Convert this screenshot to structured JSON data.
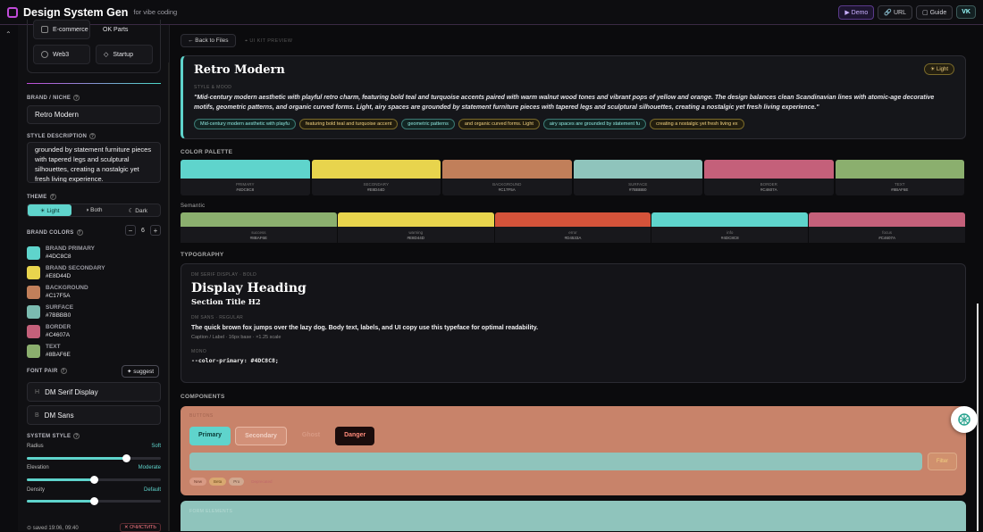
{
  "header": {
    "title": "Design System Gen",
    "subtitle": "for vibe coding",
    "demo": "▶ Demo",
    "url": "URL",
    "guide": "Guide",
    "user": "VK"
  },
  "sidebar": {
    "niches": [
      "E-commerce",
      "OK Parts",
      "Web3",
      "Startup"
    ],
    "brand_label": "BRAND / NICHE",
    "brand_value": "Retro Modern",
    "style_label": "STYLE DESCRIPTION",
    "style_text": "grounded by statement furniture pieces with tapered legs and sculptural silhouettes, creating a nostalgic yet fresh living experience.",
    "theme_label": "THEME",
    "theme_options": [
      "☀ Light",
      "◑ Both",
      "☾ Dark"
    ],
    "brand_colors_label": "BRAND COLORS",
    "color_count": "6",
    "colors": [
      {
        "name": "BRAND PRIMARY",
        "hex": "#4DC8C8",
        "color": "#5fd4cc"
      },
      {
        "name": "BRAND SECONDARY",
        "hex": "#E8D44D",
        "color": "#e8d44d"
      },
      {
        "name": "BACKGROUND",
        "hex": "#C17F5A",
        "color": "#c17f5a"
      },
      {
        "name": "SURFACE",
        "hex": "#7BBBB0",
        "color": "#7bbbb0"
      },
      {
        "name": "BORDER",
        "hex": "#C4607A",
        "color": "#c4607a"
      },
      {
        "name": "TEXT",
        "hex": "#8BAF6E",
        "color": "#8baf6e"
      }
    ],
    "font_pair_label": "FONT PAIR",
    "suggest": "✦ suggest",
    "heading_font": "DM Serif Display",
    "body_font": "DM Sans",
    "system_style_label": "SYSTEM STYLE",
    "radius_label": "Radius",
    "radius_value": "Soft",
    "radius_level": 0.74,
    "elevation_label": "Elevation",
    "elevation_value": "Moderate",
    "elevation_level": 0.5,
    "density_label": "Density",
    "density_value": "Default",
    "density_level": 0.5,
    "saved": "⊙ saved 19:06, 09:40",
    "clear": "✕ ОЧИСТИТЬ"
  },
  "main": {
    "back": "← Back to Files",
    "crumb": "⌖ UI KIT PREVIEW",
    "hero_title": "Retro Modern",
    "badge": "☀ Light",
    "style_mood": "STYLE & MOOD",
    "description": "\"Mid-century modern aesthetic with playful retro charm, featuring bold teal and turquoise accents paired with warm walnut wood tones and vibrant pops of yellow and orange. The design balances clean Scandinavian lines with atomic-age decorative motifs, geometric patterns, and organic curved forms. Light, airy spaces are grounded by statement furniture pieces with tapered legs and sculptural silhouettes, creating a nostalgic yet fresh living experience.\"",
    "pills": [
      {
        "text": "Mid-century modern aesthetic with playfu",
        "tone": "t"
      },
      {
        "text": "featuring bold teal and turquoise accent",
        "tone": "y"
      },
      {
        "text": "geometric patterns",
        "tone": "t"
      },
      {
        "text": "and organic curved forms. Light",
        "tone": "y"
      },
      {
        "text": "airy spaces are grounded by statement fu",
        "tone": "t"
      },
      {
        "text": "creating a nostalgic yet fresh living ex",
        "tone": "y"
      }
    ],
    "palette_label": "COLOR PALETTE",
    "palette": [
      {
        "name": "PRIMARY",
        "hex": "#4DC8C8",
        "color": "#5fd4cc"
      },
      {
        "name": "SECONDARY",
        "hex": "#E8D44D",
        "color": "#e8d44d"
      },
      {
        "name": "BACKGROUND",
        "hex": "#C17F5A",
        "color": "#c17f5a"
      },
      {
        "name": "SURFACE",
        "hex": "#7BBBB0",
        "color": "#8fc4bc"
      },
      {
        "name": "BORDER",
        "hex": "#C4607A",
        "color": "#c4607a"
      },
      {
        "name": "TEXT",
        "hex": "#8BAF6E",
        "color": "#8baf6e"
      }
    ],
    "semantic_label": "Semantic",
    "semantic": [
      {
        "name": "success",
        "hex": "#8BAF6E",
        "color": "#8baf6e"
      },
      {
        "name": "warning",
        "hex": "#E8D44D",
        "color": "#e8d44d"
      },
      {
        "name": "error",
        "hex": "#D4533A",
        "color": "#d4533a"
      },
      {
        "name": "info",
        "hex": "#4DC8C8",
        "color": "#5fd4cc"
      },
      {
        "name": "focus",
        "hex": "#C4607A",
        "color": "#c4607a"
      }
    ],
    "typography_label": "TYPOGRAPHY",
    "heading_meta": "DM SERIF DISPLAY · BOLD",
    "display_heading": "Display Heading",
    "section_title": "Section Title H2",
    "body_meta": "DM SANS · REGULAR",
    "body_text": "The quick brown fox jumps over the lazy dog. Body text, labels, and UI copy use this typeface for optimal readability.",
    "caption": "Caption / Label · 16px base · ×1.25 scale",
    "mono_label": "MONO",
    "mono_text": "--color-primary: #4DC8C8;",
    "components_label": "COMPONENTS",
    "buttons_label": "BUTTONS",
    "buttons": [
      "Primary",
      "Secondary",
      "Ghost",
      "Danger"
    ],
    "filter": "Filter",
    "tags": [
      {
        "text": "New",
        "bg": "#d89a84",
        "fg": "#6a3a2a"
      },
      {
        "text": "Beta",
        "bg": "#d8a870",
        "fg": "#6a4a1a"
      },
      {
        "text": "Pro",
        "bg": "#d0a890",
        "fg": "#6a4a3a"
      },
      {
        "text": "Deprecated",
        "bg": "#c8836a",
        "fg": "#c06a6a"
      }
    ],
    "form_label": "FORM ELEMENTS"
  }
}
